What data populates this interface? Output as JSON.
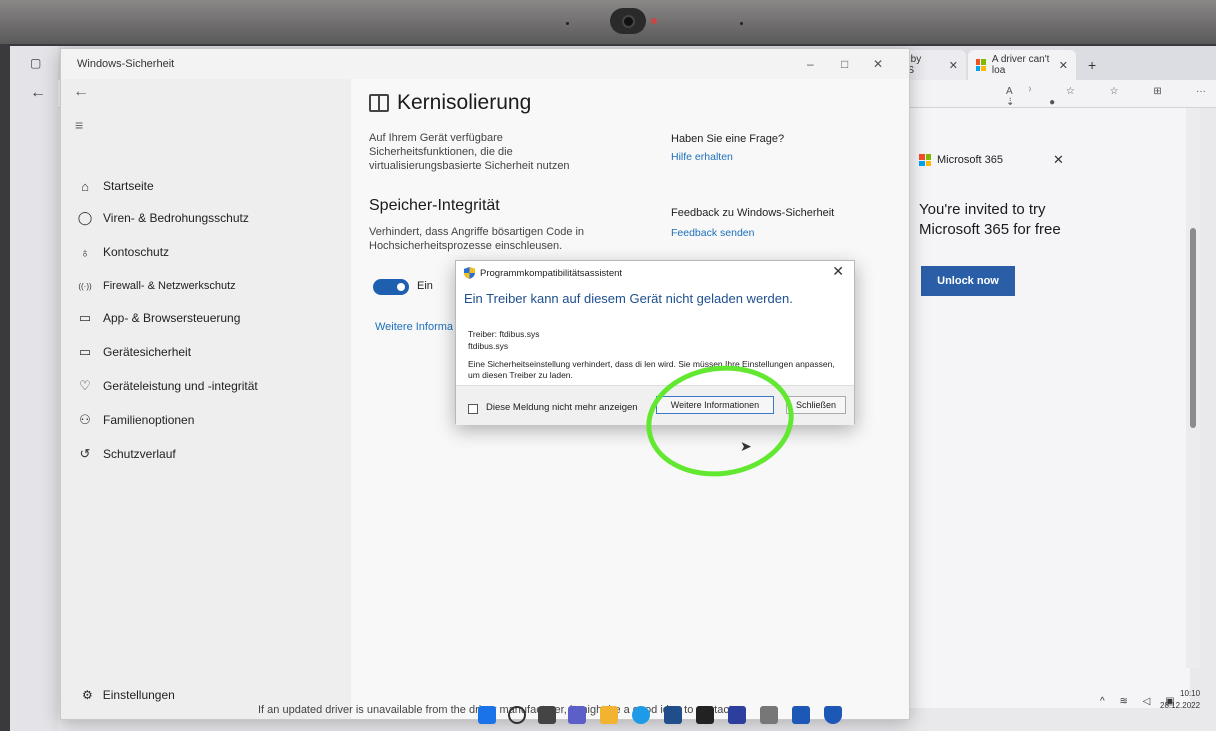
{
  "window": {
    "title": "Windows-Sicherheit",
    "minimize": "–",
    "maximize": "□",
    "close": "✕"
  },
  "browser": {
    "tabs": [
      {
        "label": "US by ASS",
        "close": "✕"
      },
      {
        "label": "A driver can't loa",
        "close": "✕"
      }
    ],
    "new_tab": "+"
  },
  "nav": {
    "back": "←",
    "menu": "≡",
    "items": [
      {
        "label": "Startseite",
        "icon": "⌂"
      },
      {
        "label": "Viren- & Bedrohungsschutz",
        "icon": "◯"
      },
      {
        "label": "Kontoschutz",
        "icon": "♁"
      },
      {
        "label": "Firewall- & Netzwerkschutz",
        "icon": "((·))"
      },
      {
        "label": "App- & Browsersteuerung",
        "icon": "▭"
      },
      {
        "label": "Gerätesicherheit",
        "icon": "▭"
      },
      {
        "label": "Geräteleistung und -integrität",
        "icon": "♡"
      },
      {
        "label": "Familienoptionen",
        "icon": "⚇"
      },
      {
        "label": "Schutzverlauf",
        "icon": "↺"
      }
    ],
    "settings": "Einstellungen",
    "settings_icon": "⚙"
  },
  "content": {
    "title": "Kernisolierung",
    "description": "Auf Ihrem Gerät verfügbare Sicherheitsfunktionen, die die virtualisierungsbasierte Sicherheit nutzen",
    "question_title": "Haben Sie eine Frage?",
    "help_link": "Hilfe erhalten",
    "section_title": "Speicher-Integrität",
    "section_desc": "Verhindert, dass Angriffe bösartigen Code in Hochsicherheitsprozesse einschleusen.",
    "feedback_title": "Feedback zu Windows-Sicherheit",
    "feedback_link": "Feedback senden",
    "toggle_label": "Ein",
    "more_link": "Weitere Informa"
  },
  "dialog": {
    "title": "Programmkompatibilitätsassistent",
    "close": "✕",
    "heading": "Ein Treiber kann auf diesem Gerät nicht geladen werden.",
    "driver_line": "Treiber: ftdibus.sys",
    "driver_file": "ftdibus.sys",
    "message": "Eine Sicherheitseinstellung verhindert, dass di              len wird. Sie müssen Ihre Einstellungen anpassen, um diesen Treiber zu laden.",
    "checkbox_label": "Diese Meldung nicht mehr anzeigen",
    "more_button": "Weitere Informationen",
    "close_button": "Schließen"
  },
  "web_page": {
    "ms365_brand": "Microsoft 365",
    "close": "✕",
    "invite_text": "You're invited to try Microsoft 365 for free",
    "unlock_button": "Unlock now",
    "bottom_text": "If an updated driver is unavailable from the driver manufacturer, it might be a good idea to contact"
  },
  "system": {
    "time": "10:10",
    "date": "28.12.2022"
  },
  "colors": {
    "accent": "#1f5fb0",
    "link": "#1d6fba",
    "highlight": "#63e832"
  }
}
